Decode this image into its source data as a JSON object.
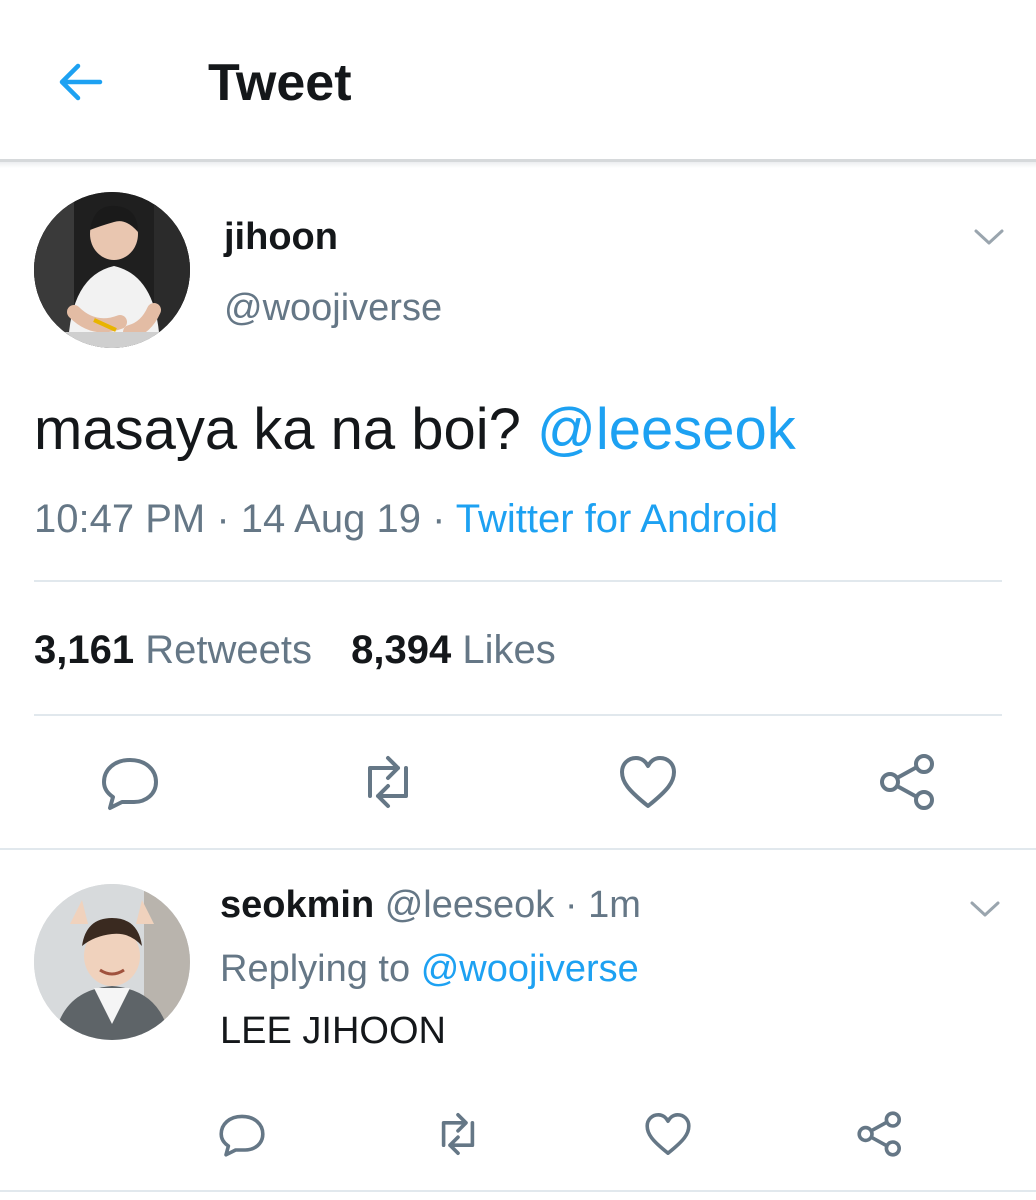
{
  "header": {
    "title": "Tweet",
    "back_icon": "arrow-left-icon"
  },
  "colors": {
    "accent": "#1da1f2",
    "secondary_text": "#657786",
    "primary_text": "#14171a"
  },
  "tweet": {
    "name": "jihoon",
    "handle": "@woojiverse",
    "text": "masaya ka na boi?",
    "mention": "@leeseok",
    "time": "10:47 PM",
    "date": "14 Aug 19",
    "source": "Twitter for Android",
    "retweets_count": "3,161",
    "retweets_label": "Retweets",
    "likes_count": "8,394",
    "likes_label": "Likes",
    "actions": [
      "reply-icon",
      "retweet-icon",
      "like-icon",
      "share-icon"
    ]
  },
  "reply": {
    "name": "seokmin",
    "handle": "@leeseok",
    "time": "1m",
    "replying_prefix": "Replying to",
    "replying_to": "@woojiverse",
    "text": "LEE JIHOON",
    "actions": [
      "reply-icon",
      "retweet-icon",
      "like-icon",
      "share-icon"
    ]
  }
}
